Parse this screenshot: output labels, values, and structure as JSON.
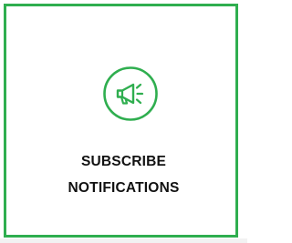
{
  "card": {
    "label_line_1": "SUBSCRIBE",
    "label_line_2": "NOTIFICATIONS",
    "icon": "megaphone-icon",
    "accent_color": "#2fae4f",
    "text_color": "#111111"
  }
}
